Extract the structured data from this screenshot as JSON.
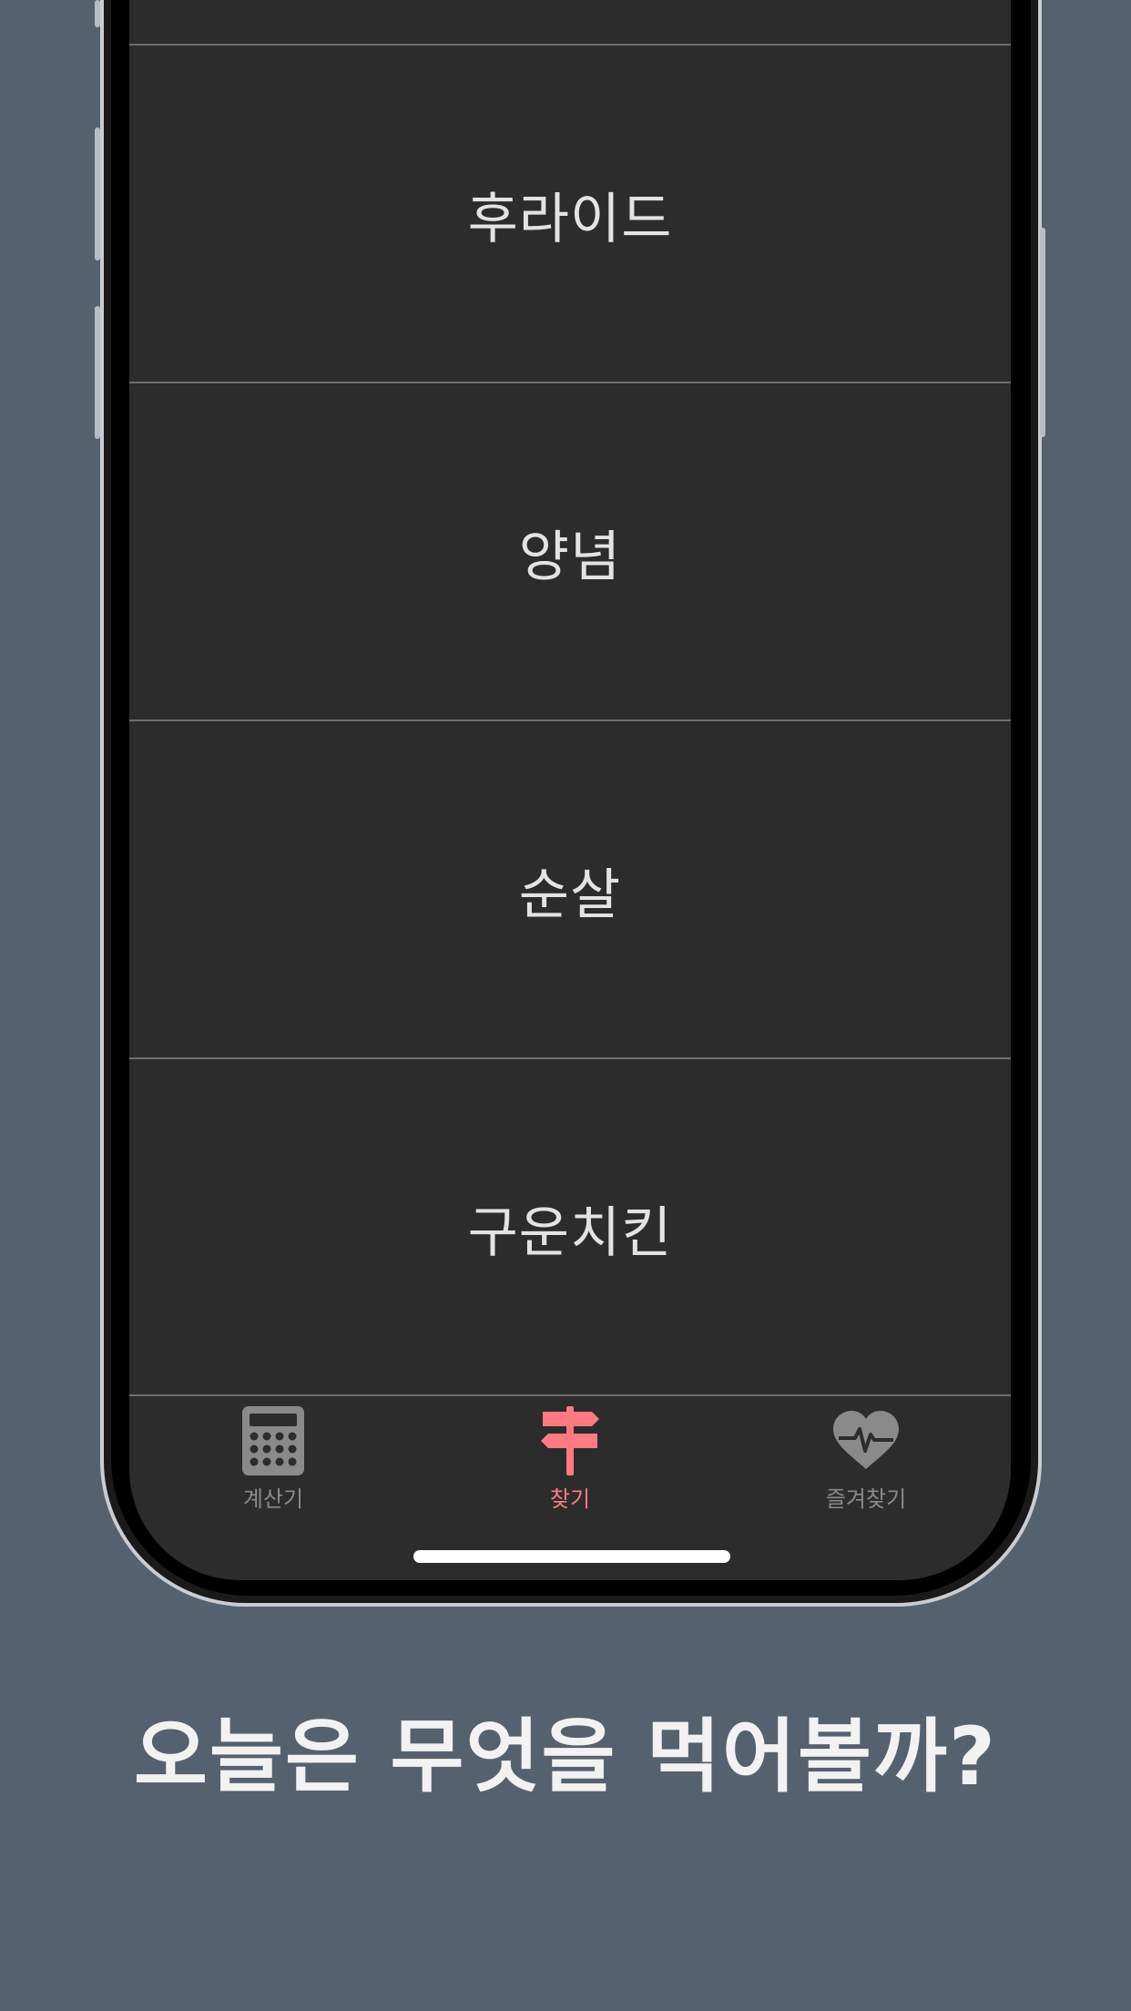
{
  "list": {
    "items": [
      {
        "label": "후라이드"
      },
      {
        "label": "양념"
      },
      {
        "label": "순살"
      },
      {
        "label": "구운치킨"
      }
    ]
  },
  "tab_bar": {
    "tabs": [
      {
        "label": "계산기",
        "icon": "calculator-icon",
        "active": false
      },
      {
        "label": "찾기",
        "icon": "signpost-icon",
        "active": true
      },
      {
        "label": "즐겨찾기",
        "icon": "heart-pulse-icon",
        "active": false
      }
    ]
  },
  "caption": {
    "text": "오늘은 무엇을 먹어볼까?"
  },
  "colors": {
    "background": "#56616f",
    "screen": "#2c2c2c",
    "accent": "#ff7a82",
    "inactive": "#8a8a8a"
  }
}
